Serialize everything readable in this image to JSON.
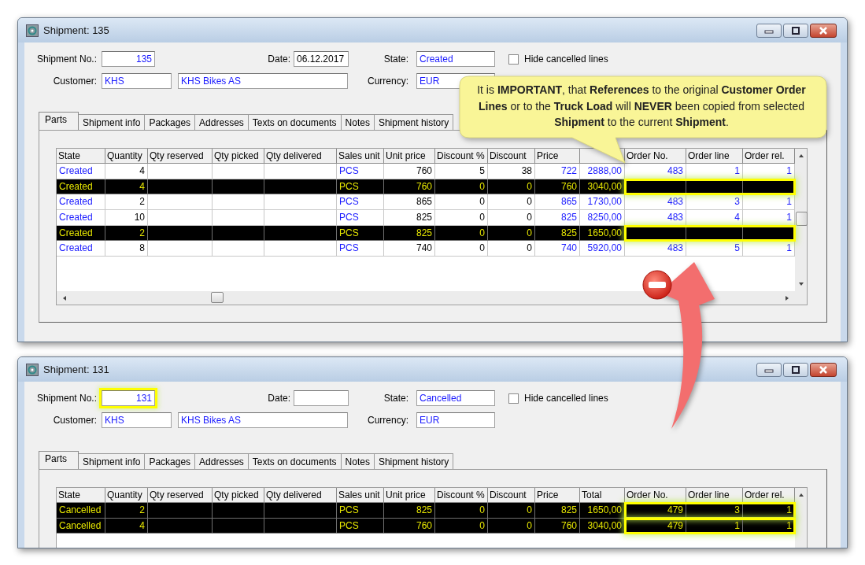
{
  "windows": [
    {
      "title": "Shipment: 135",
      "shipment_no": {
        "label": "Shipment No.:",
        "value": "135",
        "highlighted": false
      },
      "date": {
        "label": "Date:",
        "value": "06.12.2017"
      },
      "state": {
        "label": "State:",
        "value": "Created"
      },
      "hide_cancelled": {
        "label": "Hide cancelled lines",
        "checked": false
      },
      "customer": {
        "label": "Customer:",
        "code": "KHS",
        "name": "KHS Bikes AS"
      },
      "currency": {
        "label": "Currency:",
        "value": "EUR"
      },
      "tabs": [
        {
          "label": "Parts",
          "selected": true
        },
        {
          "label": "Shipment info",
          "selected": false
        },
        {
          "label": "Packages",
          "selected": false
        },
        {
          "label": "Addresses",
          "selected": false
        },
        {
          "label": "Texts on documents",
          "selected": false
        },
        {
          "label": "Notes",
          "selected": false
        },
        {
          "label": "Shipment history",
          "selected": false
        }
      ],
      "table": {
        "columns": [
          "State",
          "Quantity",
          "Qty reserved",
          "Qty picked",
          "Qty delivered",
          "Sales unit",
          "Unit price",
          "Discount %",
          "Discount",
          "Price",
          null,
          "Order No.",
          "Order line",
          "Order rel."
        ],
        "rows": [
          {
            "cells": [
              "Created",
              "4",
              null,
              null,
              null,
              "PCS",
              "760",
              "5",
              "38",
              "722",
              "2888,00",
              "483",
              "1",
              "1"
            ],
            "marked": false,
            "refs_outlined": false
          },
          {
            "cells": [
              "Created",
              "4",
              null,
              null,
              null,
              "PCS",
              "760",
              "0",
              "0",
              "760",
              "3040,00",
              null,
              null,
              null
            ],
            "marked": true,
            "refs_outlined": true
          },
          {
            "cells": [
              "Created",
              "2",
              null,
              null,
              null,
              "PCS",
              "865",
              "0",
              "0",
              "865",
              "1730,00",
              "483",
              "3",
              "1"
            ],
            "marked": false,
            "refs_outlined": false
          },
          {
            "cells": [
              "Created",
              "10",
              null,
              null,
              null,
              "PCS",
              "825",
              "0",
              "0",
              "825",
              "8250,00",
              "483",
              "4",
              "1"
            ],
            "marked": false,
            "refs_outlined": false
          },
          {
            "cells": [
              "Created",
              "2",
              null,
              null,
              null,
              "PCS",
              "825",
              "0",
              "0",
              "825",
              "1650,00",
              null,
              null,
              null
            ],
            "marked": true,
            "refs_outlined": true
          },
          {
            "cells": [
              "Created",
              "8",
              null,
              null,
              null,
              "PCS",
              "740",
              "0",
              "0",
              "740",
              "5920,00",
              "483",
              "5",
              "1"
            ],
            "marked": false,
            "refs_outlined": false
          }
        ]
      }
    },
    {
      "title": "Shipment: 131",
      "shipment_no": {
        "label": "Shipment No.:",
        "value": "131",
        "highlighted": true
      },
      "date": {
        "label": "Date:"
      },
      "state": {
        "label": "State:",
        "value": "Cancelled"
      },
      "hide_cancelled": {
        "label": "Hide cancelled lines",
        "checked": false
      },
      "customer": {
        "label": "Customer:",
        "code": "KHS",
        "name": "KHS Bikes AS"
      },
      "currency": {
        "label": "Currency:",
        "value": "EUR"
      },
      "tabs": [
        {
          "label": "Parts",
          "selected": true
        },
        {
          "label": "Shipment info",
          "selected": false
        },
        {
          "label": "Packages",
          "selected": false
        },
        {
          "label": "Addresses",
          "selected": false
        },
        {
          "label": "Texts on documents",
          "selected": false
        },
        {
          "label": "Notes",
          "selected": false
        },
        {
          "label": "Shipment history",
          "selected": false
        }
      ],
      "table": {
        "columns": [
          "State",
          "Quantity",
          "Qty reserved",
          "Qty picked",
          "Qty delivered",
          "Sales unit",
          "Unit price",
          "Discount %",
          "Discount",
          "Price",
          "Total",
          "Order No.",
          "Order line",
          "Order rel."
        ],
        "rows": [
          {
            "cells": [
              "Cancelled",
              "2",
              null,
              null,
              null,
              "PCS",
              "825",
              "0",
              "0",
              "825",
              "1650,00",
              "479",
              "3",
              "1"
            ],
            "marked": true,
            "refs_outlined": true
          },
          {
            "cells": [
              "Cancelled",
              "4",
              null,
              null,
              null,
              "PCS",
              "760",
              "0",
              "0",
              "760",
              "3040,00",
              "479",
              "1",
              "1"
            ],
            "marked": true,
            "refs_outlined": true
          }
        ]
      }
    }
  ],
  "callout": {
    "text": "It is **IMPORTANT**, that **References** to the original **Customer Order Lines** or to the **Truck Load** will **NEVER** been copied from selected **Shipment** to the current **Shipment**."
  }
}
